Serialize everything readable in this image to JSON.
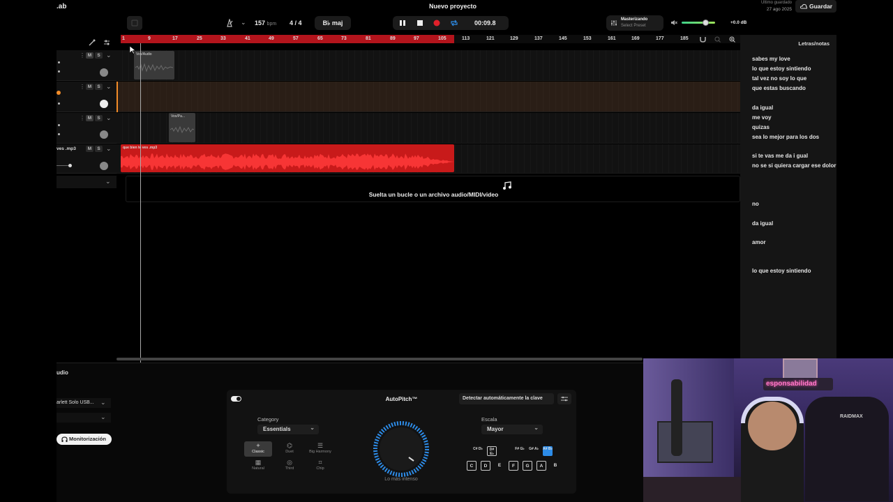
{
  "app": {
    "logo_partial": ".ab"
  },
  "topbar": {
    "tempo": "157",
    "tempo_unit": "bpm",
    "time_sig": "4 / 4",
    "key": "B♭ maj",
    "project_title": "Nuevo proyecto",
    "time": "00:09.8",
    "mastering_title": "Masterizando",
    "mastering_preset": "Select Preset",
    "volume_db": "+0.0 dB",
    "last_saved_label": "Último guardado",
    "last_saved_date": "27 ago 2025",
    "save_label": "Guardar"
  },
  "ruler": {
    "ticks": [
      "1",
      "9",
      "17",
      "25",
      "33",
      "41",
      "49",
      "57",
      "65",
      "73",
      "81",
      "89",
      "97",
      "105",
      "113",
      "121",
      "129",
      "137",
      "145",
      "153",
      "161",
      "169",
      "177",
      "185"
    ]
  },
  "tracks": [
    {
      "name": "",
      "clip_label": "Vox/Audio"
    },
    {
      "name": "",
      "clip_label": ""
    },
    {
      "name": "",
      "clip_label": "Vox/Pa..."
    },
    {
      "name": "ves .mp3",
      "clip_label": "que bien te ves .mp3"
    }
  ],
  "drop_zone": {
    "text": "Suelta un bucle o un archivo audio/MIDI/video"
  },
  "lyrics": {
    "title": "Letras/notas",
    "lines": [
      "sabes my love",
      "lo que estoy  sintiendo",
      "tal vez no soy lo que",
      " que estas buscando",
      "da igual",
      "me voy",
      "quizas",
      "sea lo mejor para los dos",
      "si te vas me da i gual",
      " no se si quiera cargar ese dolor",
      "no",
      "da igual",
      "amor",
      "lo que estoy sintiendo"
    ]
  },
  "bottom": {
    "section_label": "udio",
    "device": "arlett Solo USB...",
    "monitor_label": "Monitorización"
  },
  "autopitch": {
    "title": "AutoPitch™",
    "detect_label": "Detectar automáticamente la clave",
    "category_label": "Category",
    "category_value": "Essentials",
    "modes": [
      "Classic",
      "Duet",
      "Big Harmony",
      "Natural",
      "Third",
      "Chip"
    ],
    "selected_mode": "Classic",
    "knob_label": "Lo más intenso",
    "scale_label": "Escala",
    "scale_value": "Mayor",
    "white_keys": [
      "C",
      "D",
      "E",
      "F",
      "G",
      "A",
      "B"
    ],
    "sharp_keys": [
      "C# D♭",
      "D# E♭",
      "F# G♭",
      "G# A♭",
      "A# B♭"
    ],
    "active_sharp": "A# B♭"
  },
  "webcam": {
    "neon_sign": "esponsabilidad",
    "chair_brand": "RAIDMAX"
  },
  "colors": {
    "accent_red": "#b3141c",
    "clip_red": "#d61a1a",
    "blue": "#2d8ce8",
    "green": "#3fd28a"
  }
}
